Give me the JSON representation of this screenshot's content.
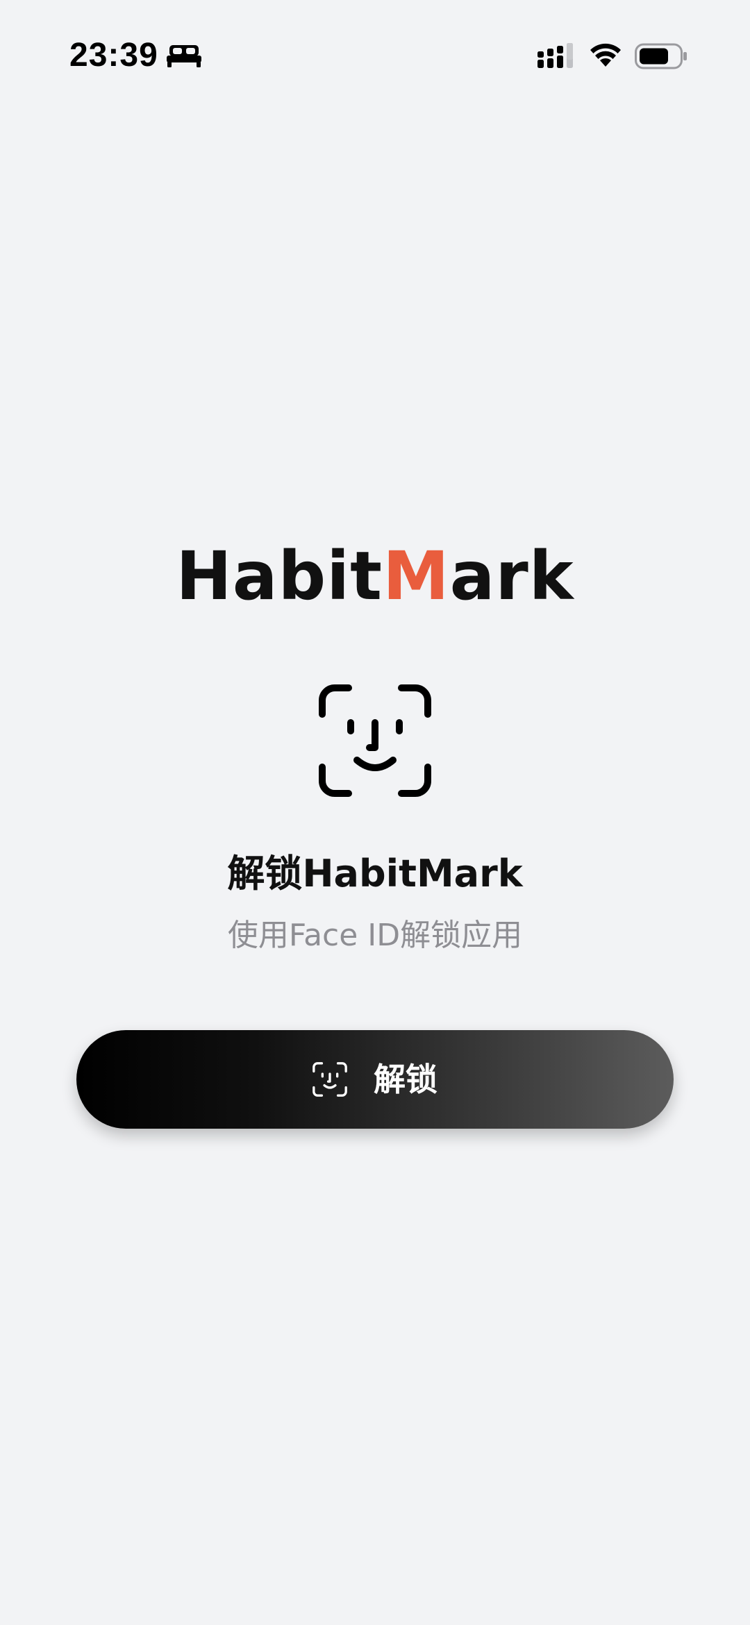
{
  "status_bar": {
    "time": "23:39",
    "icons": [
      "sleep-icon",
      "signal-icon",
      "wifi-icon",
      "battery-icon"
    ]
  },
  "logo": {
    "part1": "Habit",
    "part2": "M",
    "part3": "ark",
    "accent_color": "#e95d3d"
  },
  "face_id_icon": "face-id-icon",
  "title": "解锁HabitMark",
  "subtitle": "使用Face ID解锁应用",
  "unlock_button": {
    "icon": "face-id-icon",
    "label": "解锁"
  }
}
